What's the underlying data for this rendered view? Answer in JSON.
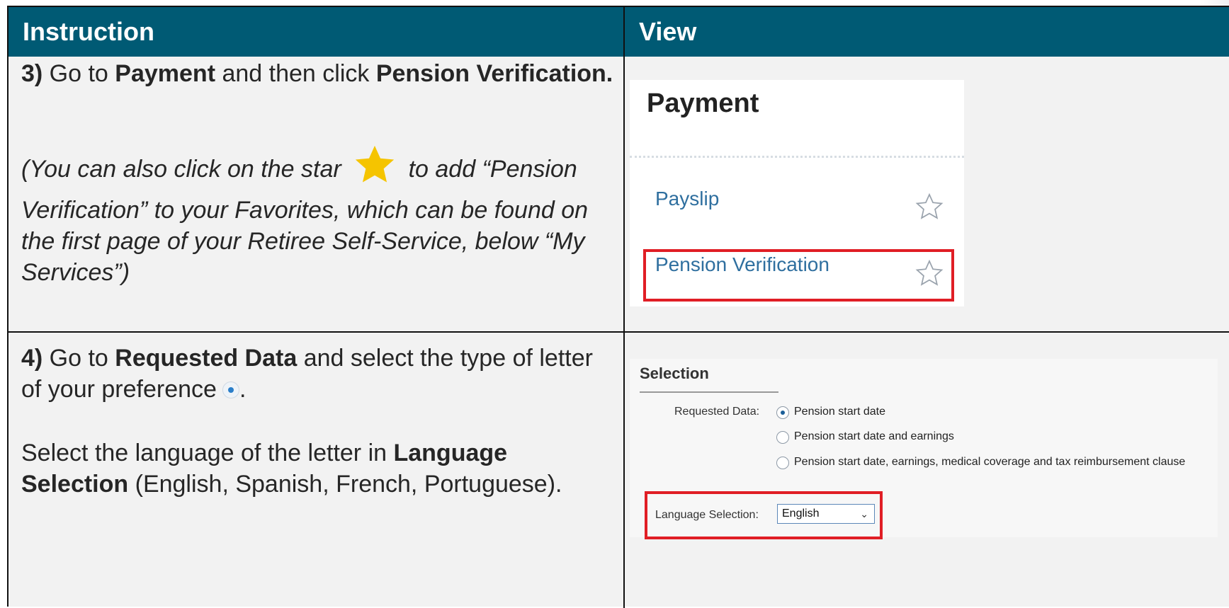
{
  "header": {
    "instruction": "Instruction",
    "view": "View"
  },
  "row3": {
    "step": "3)",
    "t1": " Go to ",
    "payment": "Payment",
    "t2": " and then click  ",
    "pension_verification": "Pension Verification.",
    "note_a": "(You can also click on the star",
    "note_b": "to add “Pension Verification” to your Favorites, which can be found on the first page of your Retiree Self-Service, below “My Services”)",
    "star_color": "#f5c400"
  },
  "payment_panel": {
    "title": "Payment",
    "items": [
      {
        "label": "Payslip"
      },
      {
        "label": "Pension Verification"
      }
    ],
    "highlight_color": "#e01e25"
  },
  "row4": {
    "step": "4)",
    "t1": " Go to ",
    "requested_data": "Requested Data",
    "t2": " and select the type of letter of your preference",
    "t3": ".",
    "p2a": "Select the language of the letter in ",
    "language_selection": "Language Selection",
    "p2b": " (English, Spanish, French, Portuguese)."
  },
  "selection_panel": {
    "title": "Selection",
    "requested_label": "Requested Data:",
    "options": [
      {
        "label": "Pension start date",
        "selected": true
      },
      {
        "label": "Pension start date and earnings",
        "selected": false
      },
      {
        "label": "Pension start date, earnings, medical coverage and tax reimbursement clause",
        "selected": false
      }
    ],
    "language_label": "Language Selection:",
    "language_value": "English"
  },
  "colors": {
    "header_bg": "#005a74",
    "link": "#2f6f9f"
  }
}
